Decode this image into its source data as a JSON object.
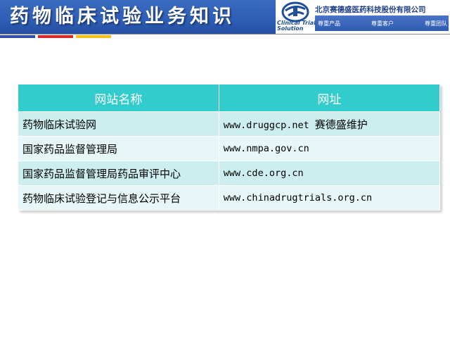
{
  "header": {
    "title": "药物临床试验业务知识",
    "company_name": "北京赛德盛医药科技股份有限公司",
    "logo_lines": [
      "Clinical Trial",
      "Solution"
    ],
    "taglines": [
      "尊重产品",
      "尊重客户",
      "尊重团队"
    ]
  },
  "colors": {
    "header_band": "#2f5fb6",
    "table_header": "#33cccc",
    "row_dark": "#cdeeee",
    "row_light": "#e7f6f6",
    "accent_blue": "#2e4fa8",
    "accent_red": "#d42a2a",
    "accent_yellow": "#f2c21a"
  },
  "table": {
    "headers": [
      "网站名称",
      "网址"
    ],
    "rows": [
      {
        "name": "药物临床试验网",
        "url": "www.druggcp.net",
        "note": "赛德盛维护"
      },
      {
        "name": "国家药品监督管理局",
        "url": "www.nmpa.gov.cn",
        "note": ""
      },
      {
        "name": "国家药品监督管理局药品审评中心",
        "url": "www.cde.org.cn",
        "note": ""
      },
      {
        "name": "药物临床试验登记与信息公示平台",
        "url": "www.chinadrugtrials.org.cn",
        "note": ""
      }
    ]
  }
}
